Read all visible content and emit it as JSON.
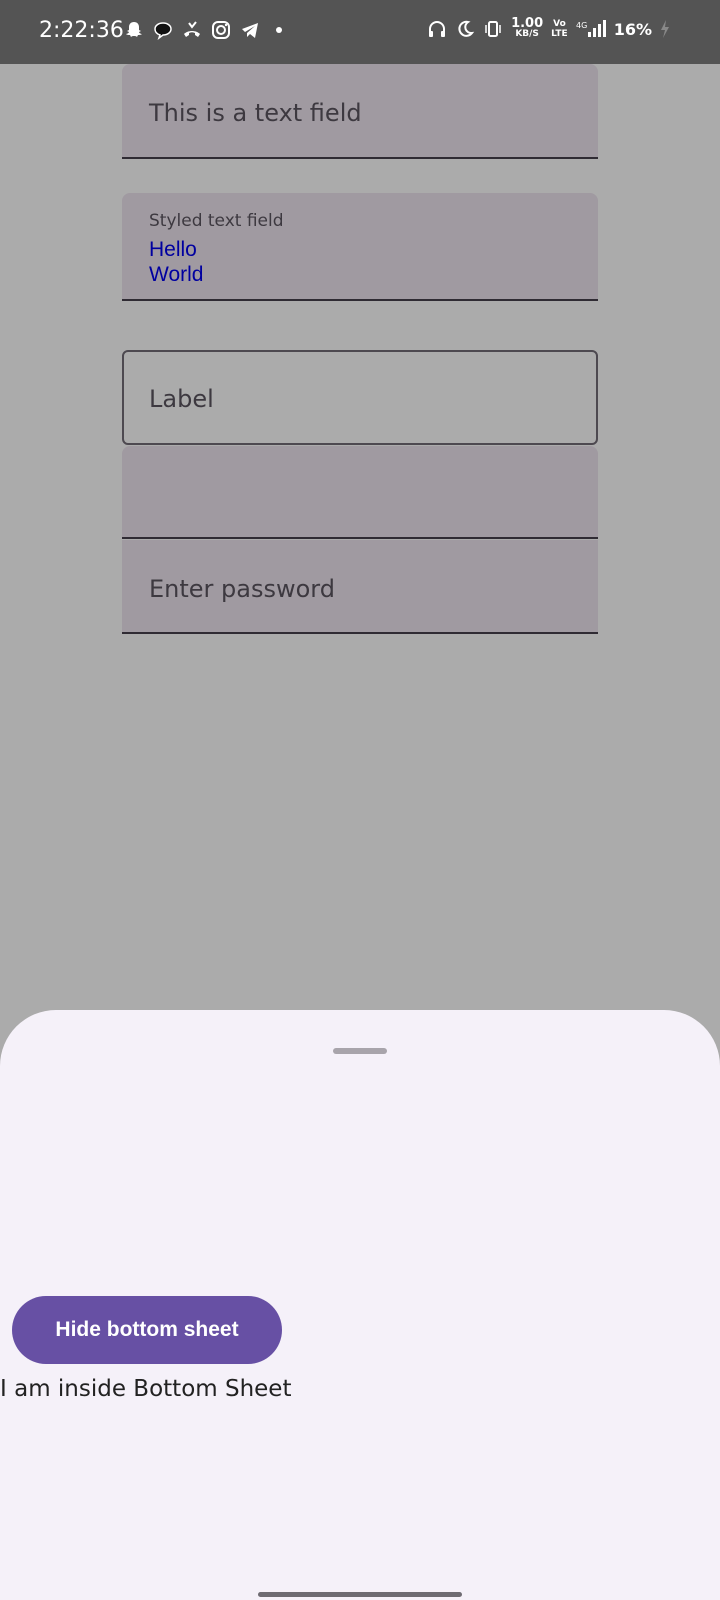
{
  "status_bar": {
    "time": "2:22:36",
    "left_icons": [
      "snapchat-icon",
      "chat-bubble-icon",
      "missed-call-icon",
      "instagram-icon",
      "telegram-icon",
      "dot-icon"
    ],
    "net_speed_value": "1.00",
    "net_speed_unit": "KB/S",
    "volte_top": "Vo",
    "volte_bottom": "LTE",
    "network": "4G",
    "battery": "16%"
  },
  "fields": {
    "text_field_placeholder": "This is a text field",
    "styled_label": "Styled text field",
    "styled_value": "Hello\nWorld",
    "outlined_label": "Label",
    "empty_field_value": "",
    "password_placeholder": "Enter password"
  },
  "bottom_sheet": {
    "button_label": "Hide bottom sheet",
    "content_text": "I am inside Bottom Sheet"
  },
  "colors": {
    "scrim": "#ababab",
    "status_bar": "#545454",
    "field_fill": "#a09aa1",
    "sheet_bg": "#f5f1f9",
    "button_bg": "#6750a4",
    "styled_text": "#0000a0"
  }
}
